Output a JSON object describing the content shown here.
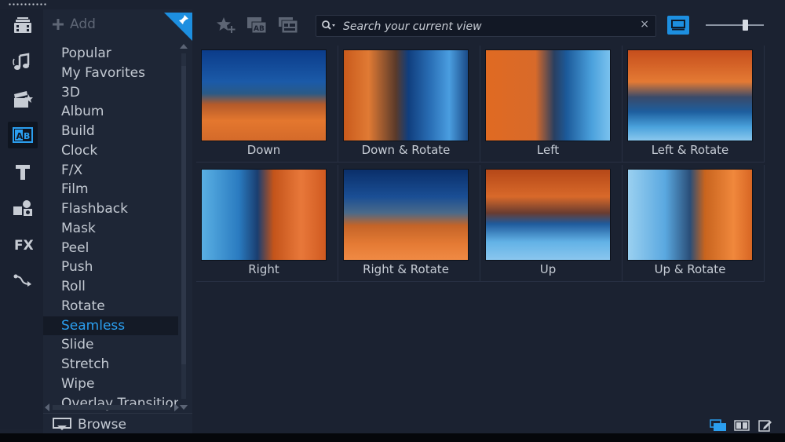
{
  "add_bar": {
    "add_label": "Add"
  },
  "categories": [
    {
      "label": "Popular"
    },
    {
      "label": "My Favorites"
    },
    {
      "label": "3D"
    },
    {
      "label": "Album"
    },
    {
      "label": "Build"
    },
    {
      "label": "Clock"
    },
    {
      "label": "F/X"
    },
    {
      "label": "Film"
    },
    {
      "label": "Flashback"
    },
    {
      "label": "Mask"
    },
    {
      "label": "Peel"
    },
    {
      "label": "Push"
    },
    {
      "label": "Roll"
    },
    {
      "label": "Rotate"
    },
    {
      "label": "Seamless",
      "selected": true
    },
    {
      "label": "Slide"
    },
    {
      "label": "Stretch"
    },
    {
      "label": "Wipe"
    },
    {
      "label": "Overlay Transitions"
    }
  ],
  "browse": {
    "label": "Browse"
  },
  "search": {
    "placeholder": "Search your current view",
    "value": ""
  },
  "thumbnails": [
    {
      "label": "Down"
    },
    {
      "label": "Down & Rotate"
    },
    {
      "label": "Left"
    },
    {
      "label": "Left & Rotate"
    },
    {
      "label": "Right"
    },
    {
      "label": "Right & Rotate"
    },
    {
      "label": "Up"
    },
    {
      "label": "Up & Rotate"
    }
  ],
  "zoom_level": 0.7,
  "icons": {
    "sidebar": [
      "media-icon",
      "audio-icon",
      "instant-project-icon",
      "transition-icon",
      "title-icon",
      "graphics-icon",
      "fx-icon",
      "path-icon"
    ],
    "toolbar": [
      "add-favorite-icon",
      "apply-transition-icon",
      "apply-all-icon",
      "search-icon",
      "clear-icon",
      "thumbnail-view-icon"
    ],
    "bottom": [
      "library-view-icon",
      "split-view-icon",
      "edit-icon"
    ]
  },
  "colors": {
    "accent": "#1d8fe0",
    "selected_text": "#2b9ff0",
    "background": "#1b2231"
  }
}
